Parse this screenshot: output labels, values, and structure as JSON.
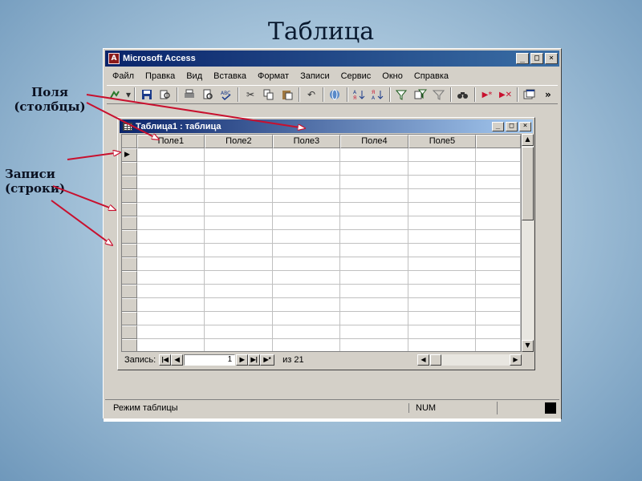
{
  "slide": {
    "title": "Таблица",
    "callout_fields_line1": "Поля",
    "callout_fields_line2": "(столбцы)",
    "callout_records_line1": "Записи",
    "callout_records_line2": "(строки)"
  },
  "app": {
    "title": "Microsoft Access",
    "icon_letter": "A",
    "window_buttons": [
      "_",
      "□",
      "×"
    ]
  },
  "menu": {
    "items": [
      "Файл",
      "Правка",
      "Вид",
      "Вставка",
      "Формат",
      "Записи",
      "Сервис",
      "Окно",
      "Справка"
    ]
  },
  "toolbar": {
    "icons": [
      "view-icon",
      "save-icon",
      "search-db-icon",
      "print-icon",
      "print-preview-icon",
      "spelling-icon",
      "cut-icon",
      "copy-icon",
      "paste-icon",
      "undo-icon",
      "hyperlink-icon",
      "sort-asc-icon",
      "sort-desc-icon",
      "filter-selection-icon",
      "filter-form-icon",
      "apply-filter-icon",
      "find-icon",
      "new-record-icon",
      "delete-record-icon",
      "database-window-icon"
    ],
    "more": "»"
  },
  "table_window": {
    "title": "Таблица1 : таблица",
    "columns": [
      "Поле1",
      "Поле2",
      "Поле3",
      "Поле4",
      "Поле5"
    ],
    "row_count_visible": 15,
    "current_row_marker": "▶"
  },
  "navigation": {
    "label": "Запись:",
    "current": "1",
    "total": "из 21"
  },
  "status": {
    "mode": "Режим таблицы",
    "num": "NUM"
  },
  "colors": {
    "arrow": "#c8102e",
    "title_bar": "#0a246a",
    "window_face": "#d4d0c8"
  }
}
